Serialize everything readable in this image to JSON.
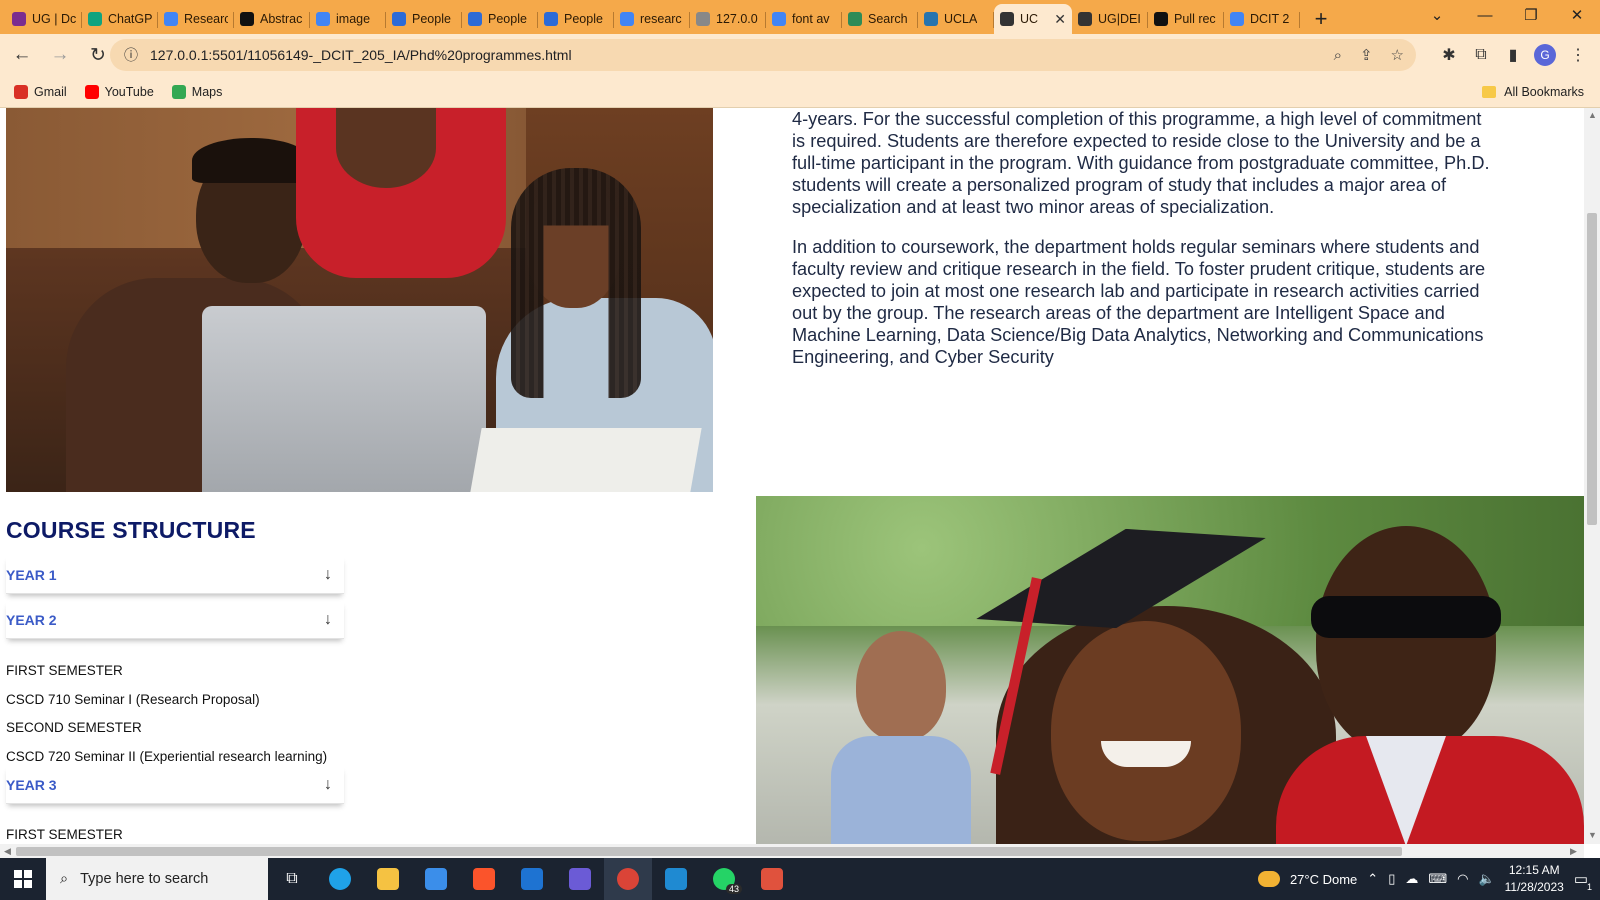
{
  "tabs": [
    {
      "label": "UG | Dc",
      "color": "#7b2d8f"
    },
    {
      "label": "ChatGP",
      "color": "#10a37f"
    },
    {
      "label": "Researc",
      "color": "#4285f4"
    },
    {
      "label": "Abstrac",
      "color": "#111111"
    },
    {
      "label": "image",
      "color": "#4285f4"
    },
    {
      "label": "People",
      "color": "#2d6bd6"
    },
    {
      "label": "People",
      "color": "#2d6bd6"
    },
    {
      "label": "People",
      "color": "#2d6bd6"
    },
    {
      "label": "researc",
      "color": "#4285f4"
    },
    {
      "label": "127.0.0",
      "color": "#888888"
    },
    {
      "label": "font av",
      "color": "#4285f4"
    },
    {
      "label": "Search",
      "color": "#2e8b57"
    },
    {
      "label": "UCLA",
      "color": "#2774ae"
    },
    {
      "label": "UC",
      "color": "#333333",
      "active": true
    },
    {
      "label": "UG|DEI",
      "color": "#333333"
    },
    {
      "label": "Pull rec",
      "color": "#111111"
    },
    {
      "label": "DCIT 2",
      "color": "#4285f4"
    }
  ],
  "toolbar": {
    "url": "127.0.0.1:5501/11056149-_DCIT_205_IA/Phd%20programmes.html"
  },
  "bookmarks": {
    "items": [
      {
        "label": "Gmail",
        "color": "#d93025"
      },
      {
        "label": "YouTube",
        "color": "#ff0000"
      },
      {
        "label": "Maps",
        "color": "#34a853"
      }
    ],
    "all_label": "All Bookmarks"
  },
  "article": {
    "p1": "4-years. For the successful completion of this programme, a high level of commitment is required. Students are therefore expected to reside close to the University and be a full-time participant in the program. With guidance from postgraduate committee, Ph.D. students will create a personalized program of study that includes a major area of specialization and at least two minor areas of specialization.",
    "p2": "In addition to coursework, the department holds regular seminars where students and faculty review and critique research in the field. To foster prudent critique, students are expected to join at most one research lab and participate in research activities carried out by the group. The research areas of the department are Intelligent Space and Machine Learning, Data Science/Big Data Analytics, Networking and Communications Engineering, and Cyber Security"
  },
  "course": {
    "title": "COURSE STRUCTURE",
    "arrow": "↓",
    "year1": "YEAR 1",
    "year2": "YEAR 2",
    "year2_items": [
      "FIRST SEMESTER",
      "CSCD 710 Seminar I (Research Proposal)",
      "SECOND SEMESTER",
      "CSCD 720 Seminar II (Experiential research learning)"
    ],
    "year3": "YEAR 3",
    "year3_items": [
      "FIRST SEMESTER"
    ]
  },
  "taskbar": {
    "search_placeholder": "Type here to search",
    "weather": "27°C  Dome",
    "time": "12:15 AM",
    "date": "11/28/2023",
    "whatsapp_badge": "43",
    "notifications": "1"
  }
}
